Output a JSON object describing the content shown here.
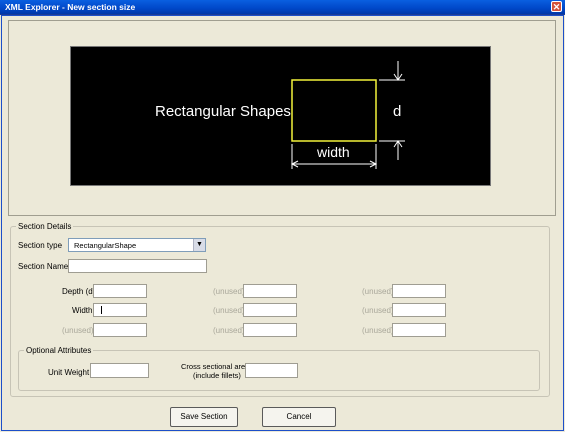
{
  "window": {
    "title": "XML Explorer - New section size",
    "close_glyph": "✕"
  },
  "diagram": {
    "shape_label": "Rectangular Shapes",
    "depth_label": "d",
    "width_label": "width"
  },
  "section_details": {
    "legend": "Section Details",
    "section_type_label": "Section type",
    "section_type_value": "RectangularShape",
    "section_name_label": "Section Name",
    "section_name_value": "",
    "depth_label": "Depth (d)",
    "width_label": "Width",
    "unused_label": "(unused)"
  },
  "optional": {
    "legend": "Optional Attributes",
    "unit_weight_label": "Unit Weight",
    "area_label_line1": "Cross sectional area",
    "area_label_line2": "(include fillets)"
  },
  "buttons": {
    "save": "Save Section",
    "cancel": "Cancel"
  },
  "icons": [
    "close-icon",
    "dropdown-arrow-icon"
  ]
}
